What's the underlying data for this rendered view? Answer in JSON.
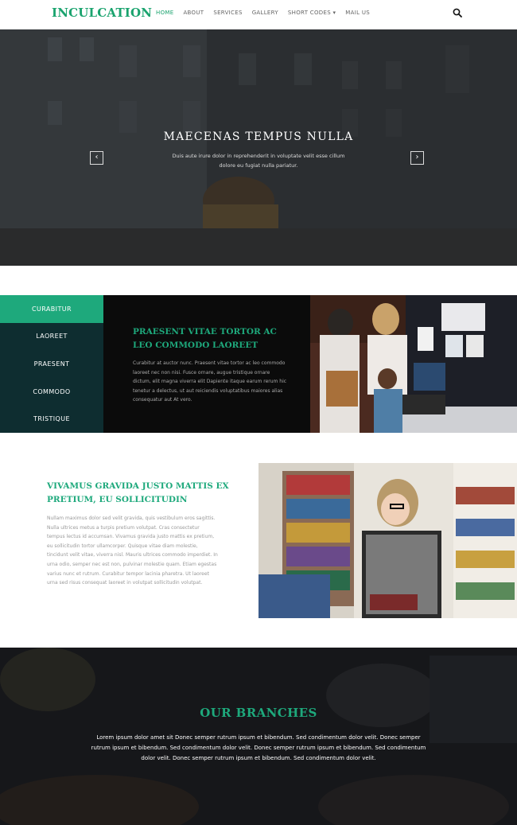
{
  "nav": {
    "logo": "INCULCATION",
    "items": [
      {
        "label": "HOME",
        "active": true
      },
      {
        "label": "ABOUT"
      },
      {
        "label": "SERVICES"
      },
      {
        "label": "GALLERY"
      },
      {
        "label": "SHORT CODES ▾"
      },
      {
        "label": "MAIL US"
      }
    ],
    "search_icon": "search-icon"
  },
  "hero": {
    "title": "MAECENAS TEMPUS NULLA",
    "text": "Duis aute irure dolor in reprehenderit in voluptate velit esse cillum dolore eu fugiat nulla pariatur.",
    "prev_icon": "‹",
    "next_icon": "›"
  },
  "tabs": {
    "items": [
      "CURABITUR",
      "LAOREET",
      "PRAESENT",
      "COMMODO",
      "TRISTIQUE"
    ],
    "active_index": 0,
    "heading": "PRAESENT VITAE TORTOR AC LEO COMMODO LAOREET",
    "body": "Curabitur at auctor nunc. Praesent vitae tortor ac leo commodo laoreet nec non nisi. Fusce ornare, augue tristique ornare dictum, elit magna viverra elit Dapiente itaque earum rerum hic tenetur a delectus, ut aut reiciendis voluptatibus maiores alias consequatur aut At vero."
  },
  "info": {
    "heading": "VIVAMUS GRAVIDA JUSTO MATTIS EX PRETIUM, EU SOLLICITUDIN",
    "body": "Nullam maximus dolor sed velit gravida, quis vestibulum eros sagittis. Nulla ultrices metus a turpis pretium volutpat. Cras consectetur tempus lectus id accumsan. Vivamus gravida justo mattis ex pretium, eu sollicitudin tortor ullamcorper. Quisque vitae diam molestie, tincidunt velit vitae, viverra nisl. Mauris ultrices commodo imperdiet. In urna odio, semper nec est non, pulvinar molestie quam. Etiam egestas varius nunc et rutrum. Curabitur tempor lacinia pharetra. Ut laoreet urna sed risus consequat laoreet in volutpat sollicitudin volutpat."
  },
  "branches": {
    "title": "OUR BRANCHES",
    "text": "Lorem ipsum dolor amet sit Donec semper rutrum ipsum et bibendum. Sed condimentum dolor velit. Donec semper rutrum ipsum et bibendum. Sed condimentum dolor velit. Donec semper rutrum ipsum et bibendum. Sed condimentum dolor velit. Donec semper rutrum ipsum et bibendum. Sed condimentum dolor velit."
  },
  "colors": {
    "accent": "#1ea97c",
    "tab_bg": "#0e2d30",
    "dark": "#0b0b0b"
  }
}
